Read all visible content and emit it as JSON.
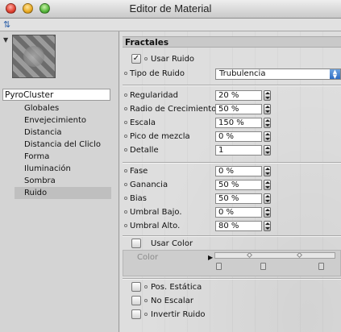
{
  "window": {
    "title": "Editor de Material"
  },
  "left": {
    "object_name": "PyroCluster",
    "items": [
      "Globales",
      "Envejecimiento",
      "Distancia",
      "Distancia del Cliclo",
      "Forma",
      "Iluminación",
      "Sombra",
      "Ruido"
    ],
    "selected": "Ruido"
  },
  "fractales": {
    "section_title": "Fractales",
    "usar_ruido": {
      "label": "Usar Ruido",
      "checked": true
    },
    "tipo_de_ruido": {
      "label": "Tipo de Ruido",
      "value": "Trubulencia"
    },
    "group1": [
      {
        "label": "Regularidad",
        "value": "20 %"
      },
      {
        "label": "Radio de Crecimiento",
        "value": "50 %"
      },
      {
        "label": "Escala",
        "value": "150 %"
      },
      {
        "label": "Pico de mezcla",
        "value": "0 %"
      },
      {
        "label": "Detalle",
        "value": "1"
      }
    ],
    "group2": [
      {
        "label": "Fase",
        "value": "0 %"
      },
      {
        "label": "Ganancia",
        "value": "50 %"
      },
      {
        "label": "Bias",
        "value": "50 %"
      },
      {
        "label": "Umbral Bajo.",
        "value": "0 %"
      },
      {
        "label": "Umbral Alto.",
        "value": "80 %"
      }
    ],
    "usar_color": {
      "label": "Usar Color",
      "checked": false
    },
    "color": {
      "label": "Color"
    },
    "bottom_checks": [
      {
        "label": "Pos. Estática",
        "checked": false
      },
      {
        "label": "No Escalar",
        "checked": false
      },
      {
        "label": "Invertir Ruido",
        "checked": false
      }
    ]
  },
  "colors": {
    "accent": "#2d6cc2",
    "selection": "#bfbfbf"
  }
}
